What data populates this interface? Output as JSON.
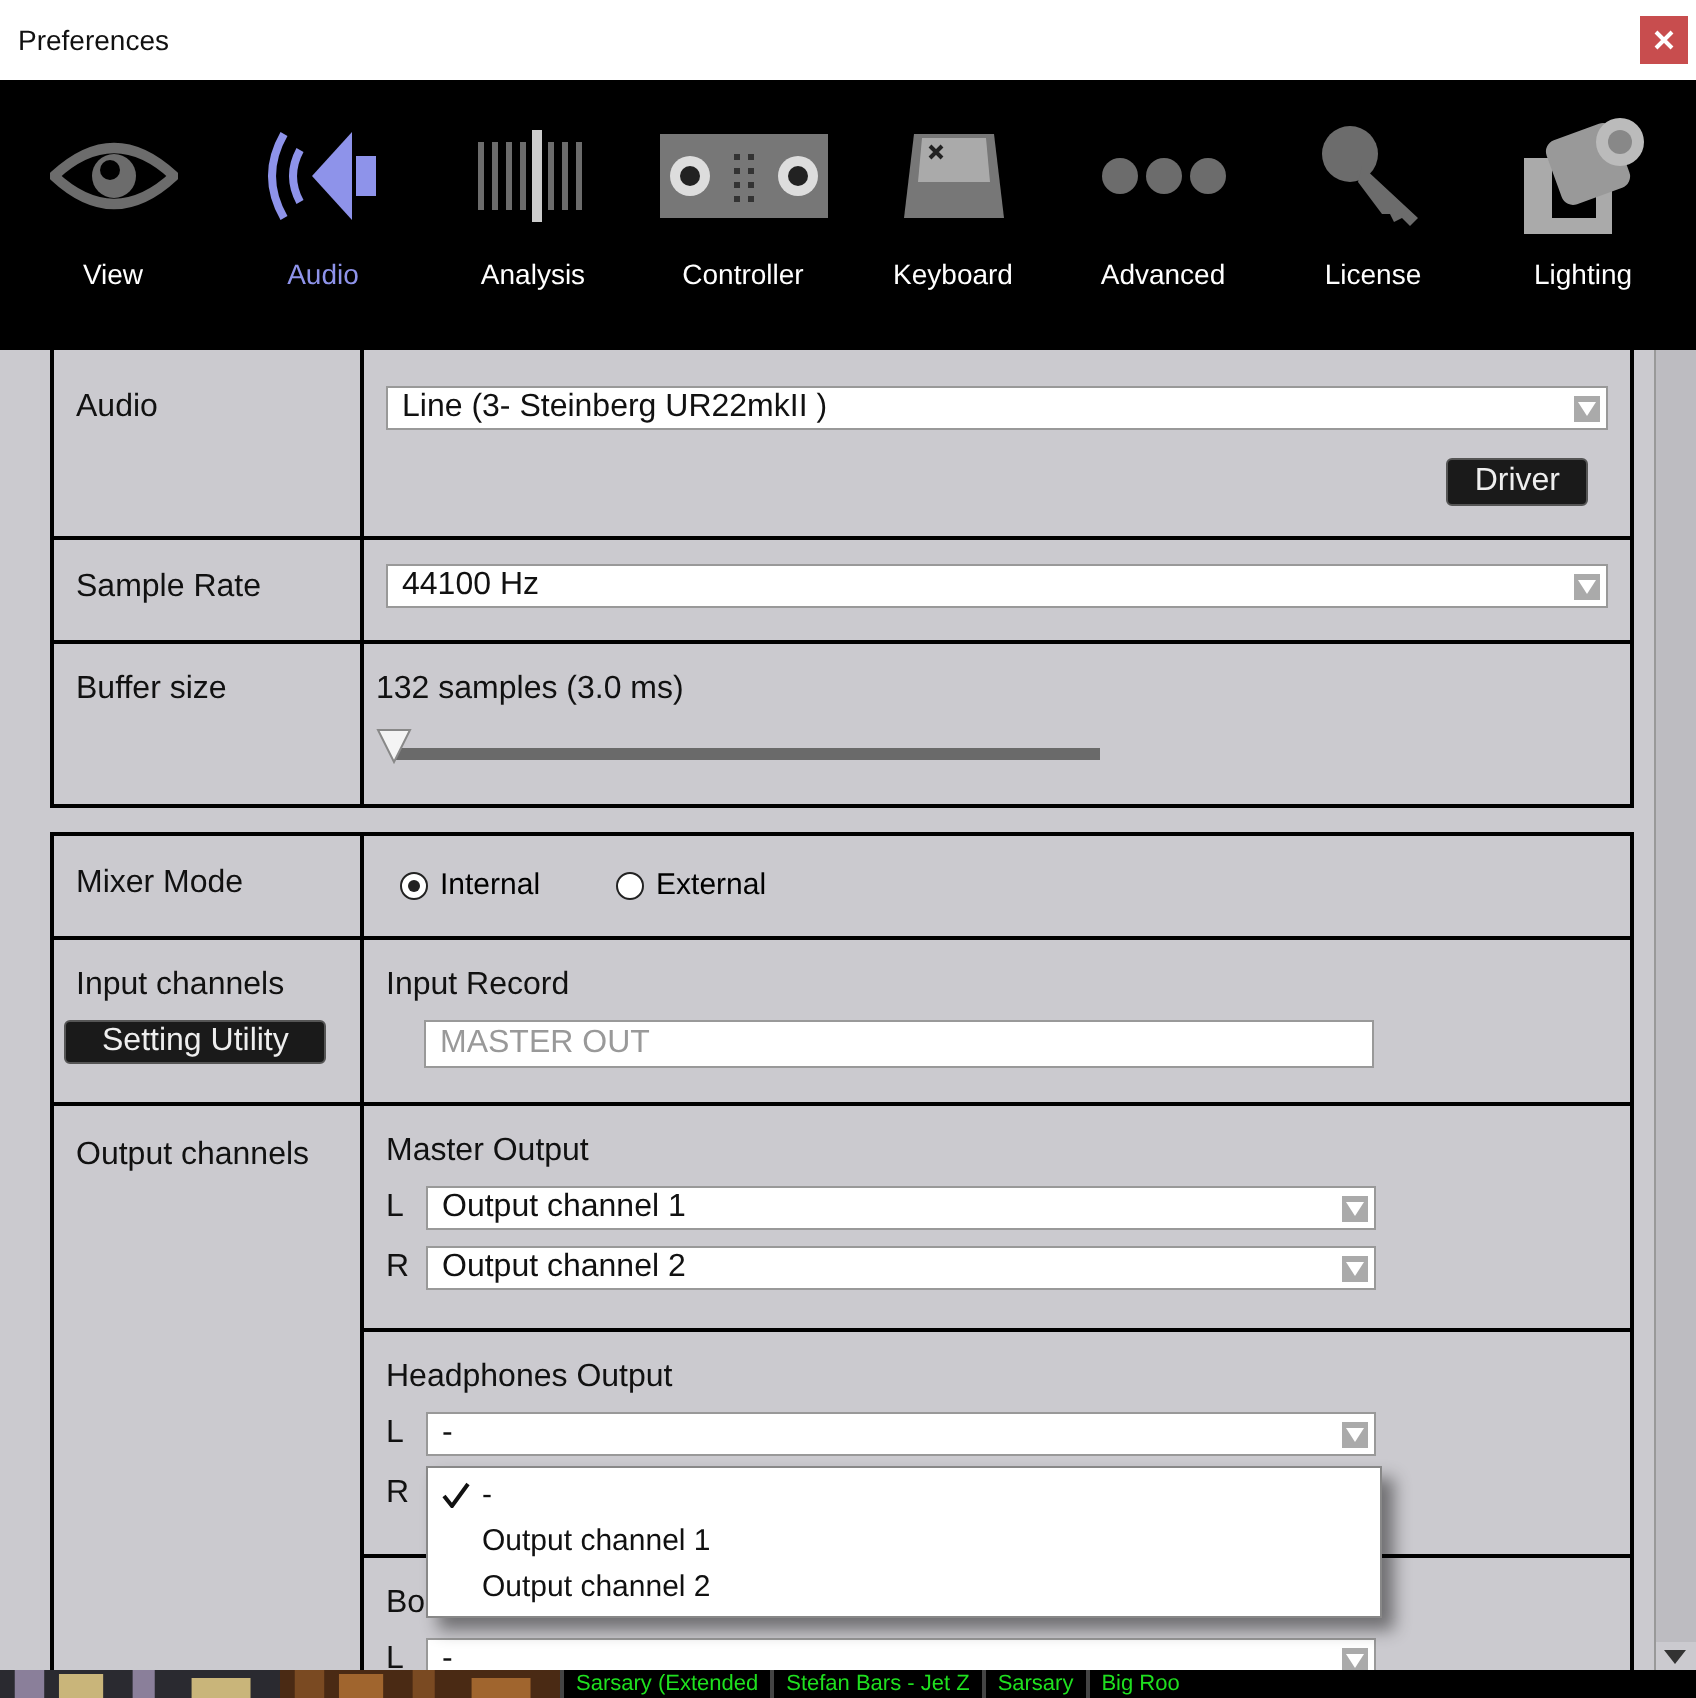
{
  "window": {
    "title": "Preferences"
  },
  "toolbar": {
    "items": [
      {
        "label": "View",
        "selected": false
      },
      {
        "label": "Audio",
        "selected": true
      },
      {
        "label": "Analysis",
        "selected": false
      },
      {
        "label": "Controller",
        "selected": false
      },
      {
        "label": "Keyboard",
        "selected": false
      },
      {
        "label": "Advanced",
        "selected": false
      },
      {
        "label": "License",
        "selected": false
      },
      {
        "label": "Lighting",
        "selected": false
      }
    ]
  },
  "device_settings": {
    "audio": {
      "label": "Audio",
      "device": "Line (3- Steinberg UR22mkII )",
      "driver_button": "Driver"
    },
    "sample_rate": {
      "label": "Sample Rate",
      "value": "44100 Hz"
    },
    "buffer_size": {
      "label": "Buffer size",
      "reading": "132 samples (3.0 ms)",
      "level": 0
    }
  },
  "mixer": {
    "mixer_mode": {
      "label": "Mixer Mode",
      "options": [
        {
          "label": "Internal",
          "selected": true
        },
        {
          "label": "External",
          "selected": false
        }
      ]
    },
    "input_channels": {
      "label": "Input channels",
      "button": "Setting Utility",
      "input_record": {
        "label": "Input Record",
        "placeholder": "MASTER OUT"
      }
    },
    "output_channels": {
      "label": "Output channels",
      "groups": [
        {
          "title": "Master Output",
          "channels": [
            {
              "side": "L",
              "value": "Output channel 1"
            },
            {
              "side": "R",
              "value": "Output channel 2"
            }
          ]
        },
        {
          "title": "Headphones Output",
          "channels": [
            {
              "side": "L",
              "value": "-"
            },
            {
              "side": "R"
            }
          ],
          "dropdown_menu": {
            "items": [
              {
                "label": "-",
                "selected": true
              },
              {
                "label": "Output channel 1",
                "selected": false
              },
              {
                "label": "Output channel 2",
                "selected": false
              }
            ]
          }
        },
        {
          "title": "Bo",
          "channels": [
            {
              "side": "L",
              "value": "-"
            }
          ]
        }
      ]
    }
  },
  "track_strip": {
    "items": [
      {
        "kind": "picture"
      },
      {
        "kind": "picture"
      },
      {
        "kind": "title",
        "text": "Sarsary (Extended"
      },
      {
        "kind": "title",
        "text": "Stefan Bars - Jet Z"
      },
      {
        "kind": "title",
        "text": "Sarsary"
      },
      {
        "kind": "title",
        "text": "Big Roo"
      }
    ]
  }
}
